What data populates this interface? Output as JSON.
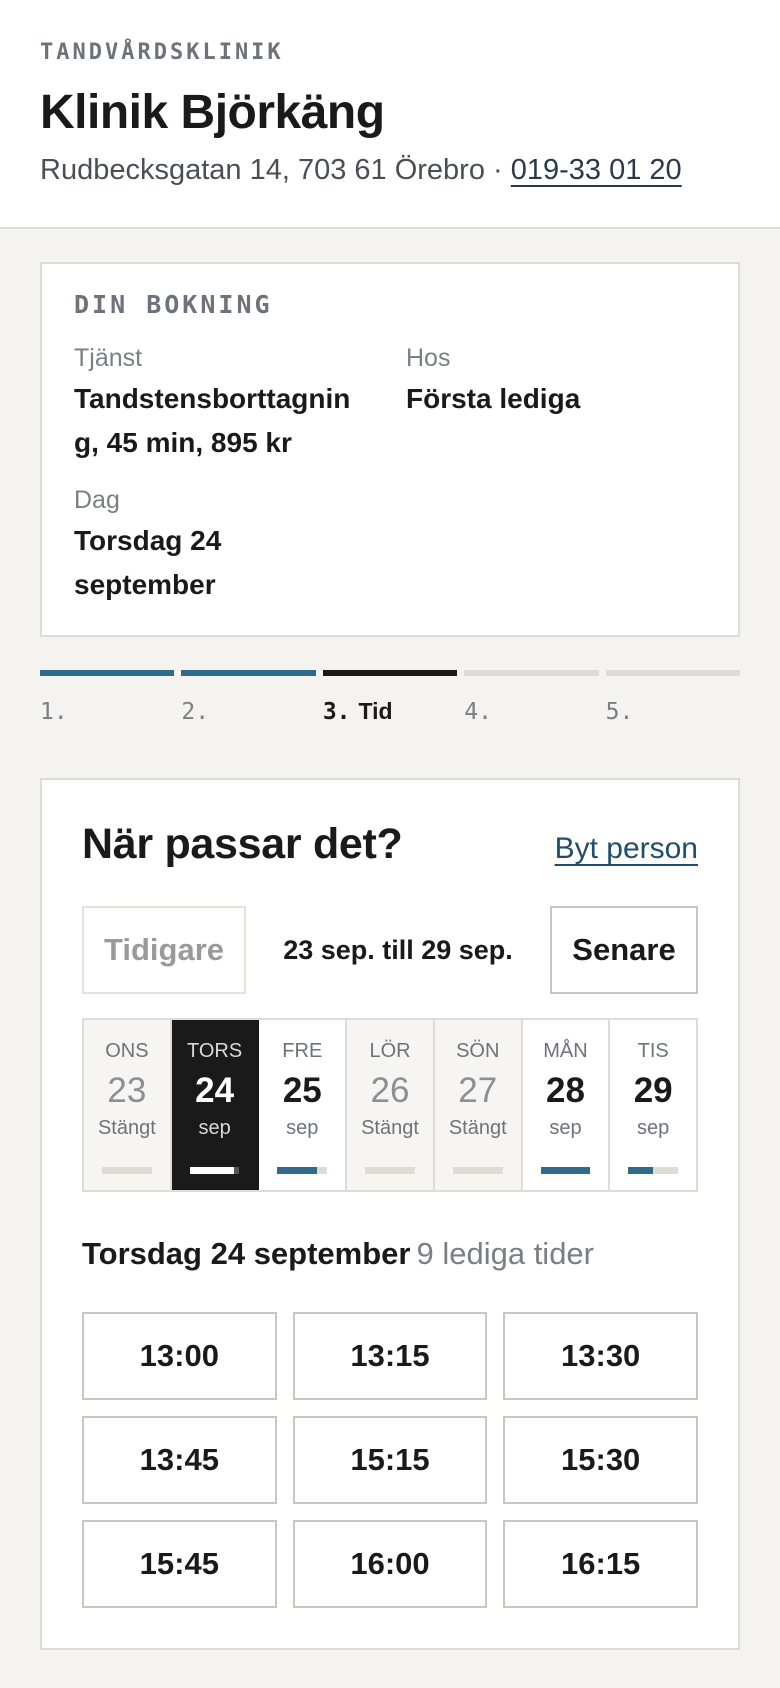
{
  "header": {
    "eyebrow": "TANDVÅRDSKLINIK",
    "clinic_name": "Klinik Björkäng",
    "address": "Rudbecksgatan 14, 703 61 Örebro · ",
    "phone": "019-33 01 20"
  },
  "booking": {
    "title": "DIN BOKNING",
    "service_label": "Tjänst",
    "service_value": "Tandstensborttagning, 45 min, 895 kr",
    "provider_label": "Hos",
    "provider_value": "Första lediga",
    "day_label": "Dag",
    "day_value": "Torsdag 24 september"
  },
  "steps": [
    {
      "num": "1.",
      "label": "",
      "state": "done"
    },
    {
      "num": "2.",
      "label": "",
      "state": "done"
    },
    {
      "num": "3.",
      "label": "Tid",
      "state": "active"
    },
    {
      "num": "4.",
      "label": "",
      "state": "upcoming"
    },
    {
      "num": "5.",
      "label": "",
      "state": "upcoming"
    }
  ],
  "main": {
    "heading": "När passar det?",
    "switch_link": "Byt person",
    "prev_label": "Tidigare",
    "next_label": "Senare",
    "range": "23 sep. till 29 sep."
  },
  "days": [
    {
      "name": "ONS",
      "num": "23",
      "sub": "Stängt",
      "closed": true,
      "selected": false,
      "availability": 0
    },
    {
      "name": "TORS",
      "num": "24",
      "sub": "sep",
      "closed": false,
      "selected": true,
      "availability": 0.9
    },
    {
      "name": "FRE",
      "num": "25",
      "sub": "sep",
      "closed": false,
      "selected": false,
      "availability": 0.8
    },
    {
      "name": "LÖR",
      "num": "26",
      "sub": "Stängt",
      "closed": true,
      "selected": false,
      "availability": 0
    },
    {
      "name": "SÖN",
      "num": "27",
      "sub": "Stängt",
      "closed": true,
      "selected": false,
      "availability": 0
    },
    {
      "name": "MÅN",
      "num": "28",
      "sub": "sep",
      "closed": false,
      "selected": false,
      "availability": 1.0
    },
    {
      "name": "TIS",
      "num": "29",
      "sub": "sep",
      "closed": false,
      "selected": false,
      "availability": 0.5
    }
  ],
  "slots_section": {
    "date": "Torsdag 24 september",
    "count": "9 lediga tider"
  },
  "slots": [
    "13:00",
    "13:15",
    "13:30",
    "13:45",
    "15:15",
    "15:30",
    "15:45",
    "16:00",
    "16:15"
  ],
  "colors": {
    "accent": "#2f6b88",
    "selected": "#1a1a1a",
    "border": "#dddcd5",
    "background": "#f4f3ef"
  }
}
